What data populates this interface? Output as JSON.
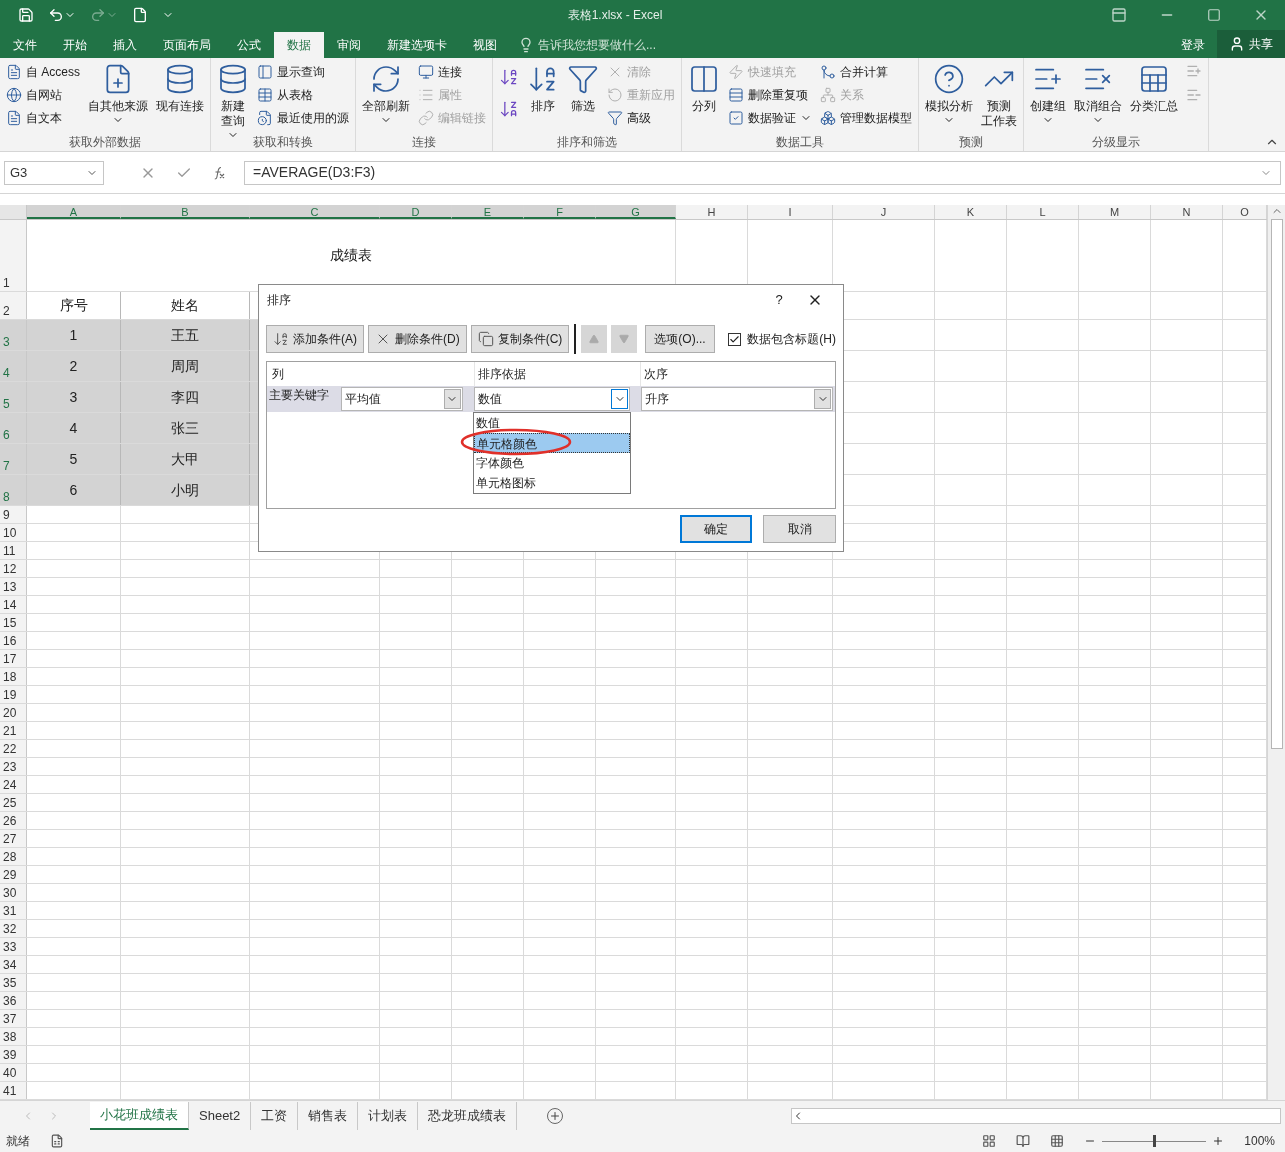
{
  "window": {
    "title": "表格1.xlsx - Excel"
  },
  "ribbon_tabs": [
    {
      "label": "文件",
      "selected": false
    },
    {
      "label": "开始",
      "selected": false
    },
    {
      "label": "插入",
      "selected": false
    },
    {
      "label": "页面布局",
      "selected": false
    },
    {
      "label": "公式",
      "selected": false
    },
    {
      "label": "数据",
      "selected": true
    },
    {
      "label": "审阅",
      "selected": false
    },
    {
      "label": "新建选项卡",
      "selected": false
    },
    {
      "label": "视图",
      "selected": false
    }
  ],
  "tell_me": {
    "placeholder": "告诉我您想要做什么..."
  },
  "account": {
    "sign_in": "登录",
    "share": "共享"
  },
  "ribbon_groups": [
    {
      "label": "获取外部数据",
      "items": [
        {
          "kind": "stack",
          "items": [
            {
              "label": "自 Access",
              "disabled": false,
              "caret": false
            },
            {
              "label": "自网站",
              "disabled": false,
              "caret": false
            },
            {
              "label": "自文本",
              "disabled": false,
              "caret": false
            }
          ]
        },
        {
          "kind": "large",
          "label": "自其他来源",
          "disabled": false,
          "caret": true
        },
        {
          "kind": "large",
          "label": "现有连接",
          "disabled": false,
          "caret": false
        }
      ]
    },
    {
      "label": "获取和转换",
      "items": [
        {
          "kind": "large",
          "lines": [
            "新建",
            "查询"
          ],
          "disabled": false,
          "caret": true
        },
        {
          "kind": "stack",
          "items": [
            {
              "label": "显示查询",
              "disabled": false,
              "caret": false
            },
            {
              "label": "从表格",
              "disabled": false,
              "caret": false
            },
            {
              "label": "最近使用的源",
              "disabled": false,
              "caret": false
            }
          ]
        }
      ]
    },
    {
      "label": "连接",
      "items": [
        {
          "kind": "large",
          "label": "全部刷新",
          "disabled": false,
          "caret": true
        },
        {
          "kind": "stack",
          "items": [
            {
              "label": "连接",
              "disabled": false,
              "caret": false
            },
            {
              "label": "属性",
              "disabled": true,
              "caret": false
            },
            {
              "label": "编辑链接",
              "disabled": true,
              "caret": false
            }
          ]
        }
      ]
    },
    {
      "label": "排序和筛选",
      "items": [
        {
          "kind": "sort_icons"
        },
        {
          "kind": "large",
          "label": "排序",
          "disabled": false,
          "caret": false
        },
        {
          "kind": "large",
          "label": "筛选",
          "disabled": false,
          "caret": false
        },
        {
          "kind": "stack",
          "items": [
            {
              "label": "清除",
              "disabled": true,
              "caret": false
            },
            {
              "label": "重新应用",
              "disabled": true,
              "caret": false
            },
            {
              "label": "高级",
              "disabled": false,
              "caret": false
            }
          ]
        }
      ]
    },
    {
      "label": "数据工具",
      "items": [
        {
          "kind": "large",
          "label": "分列",
          "disabled": false,
          "caret": false
        },
        {
          "kind": "stack",
          "items": [
            {
              "label": "快速填充",
              "disabled": true,
              "caret": false
            },
            {
              "label": "删除重复项",
              "disabled": false,
              "caret": false
            },
            {
              "label": "数据验证",
              "disabled": false,
              "caret": true
            }
          ]
        },
        {
          "kind": "stack",
          "items": [
            {
              "label": "合并计算",
              "disabled": false,
              "caret": false
            },
            {
              "label": "关系",
              "disabled": true,
              "caret": false
            },
            {
              "label": "管理数据模型",
              "disabled": false,
              "caret": false
            }
          ]
        }
      ]
    },
    {
      "label": "预测",
      "items": [
        {
          "kind": "large",
          "label": "模拟分析",
          "disabled": false,
          "caret": true
        },
        {
          "kind": "large",
          "lines": [
            "预测",
            "工作表"
          ],
          "disabled": false,
          "caret": false
        }
      ]
    },
    {
      "label": "分级显示",
      "items": [
        {
          "kind": "large",
          "label": "创建组",
          "disabled": false,
          "caret": true
        },
        {
          "kind": "large",
          "label": "取消组合",
          "disabled": false,
          "caret": true
        },
        {
          "kind": "large",
          "label": "分类汇总",
          "disabled": false,
          "caret": false
        },
        {
          "kind": "detail_icons"
        }
      ]
    }
  ],
  "formula_bar": {
    "name_box": "G3",
    "formula": "=AVERAGE(D3:F3)"
  },
  "columns": [
    "A",
    "B",
    "C",
    "D",
    "E",
    "F",
    "G",
    "H",
    "I",
    "J",
    "K",
    "L",
    "M",
    "N",
    "O"
  ],
  "rows": [
    "1",
    "2",
    "3",
    "4",
    "5",
    "6",
    "7",
    "8",
    "9",
    "10",
    "11",
    "12",
    "13",
    "14",
    "15",
    "16",
    "17",
    "18",
    "19",
    "20",
    "21",
    "22",
    "23",
    "24",
    "25",
    "26",
    "27",
    "28",
    "29",
    "30",
    "31",
    "32",
    "33",
    "34",
    "35",
    "36",
    "37",
    "38",
    "39",
    "40",
    "41"
  ],
  "sheet": {
    "title": "成绩表",
    "headers": [
      "序号",
      "姓名"
    ],
    "records": [
      [
        "1",
        "王五"
      ],
      [
        "2",
        "周周"
      ],
      [
        "3",
        "李四"
      ],
      [
        "4",
        "张三"
      ],
      [
        "5",
        "大甲"
      ],
      [
        "6",
        "小明"
      ]
    ]
  },
  "dialog": {
    "title": "排序",
    "help": "?",
    "toolbar": [
      "添加条件(A)",
      "删除条件(D)",
      "复制条件(C)"
    ],
    "options": "选项(O)...",
    "has_headers": {
      "label": "数据包含标题(H)",
      "checked": true
    },
    "headers": [
      "列",
      "排序依据",
      "次序"
    ],
    "row": {
      "label": "主要关键字",
      "column": "平均值",
      "sort_on": "数值",
      "order": "升序"
    },
    "dropdown": [
      {
        "label": "数值",
        "selected": false
      },
      {
        "label": "单元格颜色",
        "selected": true
      },
      {
        "label": "字体颜色",
        "selected": false
      },
      {
        "label": "单元格图标",
        "selected": false
      }
    ],
    "ok": "确定",
    "cancel": "取消"
  },
  "sheet_tabs": [
    {
      "label": "小花班成绩表",
      "selected": true
    },
    {
      "label": "Sheet2",
      "selected": false
    },
    {
      "label": "工资",
      "selected": false
    },
    {
      "label": "销售表",
      "selected": false
    },
    {
      "label": "计划表",
      "selected": false
    },
    {
      "label": "恐龙班成绩表",
      "selected": false
    }
  ],
  "status_bar": {
    "status": "就绪",
    "zoom": "100%",
    "zoom_slider": {
      "level": 0.5
    }
  }
}
